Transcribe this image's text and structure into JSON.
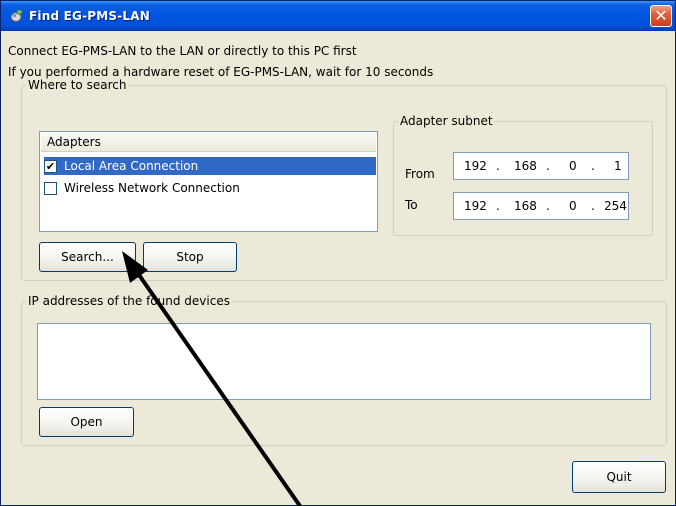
{
  "window": {
    "title": "Find EG-PMS-LAN",
    "close_glyph": "✕"
  },
  "intro": {
    "line1": "Connect EG-PMS-LAN to the LAN or directly to this PC first",
    "line2": "If you performed a hardware reset of EG-PMS-LAN, wait for 10 seconds"
  },
  "where_to_search": {
    "legend": "Where to search",
    "adapters": {
      "header": "Adapters",
      "items": [
        {
          "label": "Local Area Connection",
          "checked": true,
          "selected": true,
          "check_glyph": "✔"
        },
        {
          "label": "Wireless Network Connection",
          "checked": false,
          "selected": false,
          "check_glyph": ""
        }
      ]
    },
    "subnet": {
      "legend": "Adapter subnet",
      "from_label": "From",
      "to_label": "To",
      "from": [
        "192",
        ".",
        "168",
        ".",
        "0",
        ".",
        "1"
      ],
      "to": [
        "192",
        ".",
        "168",
        ".",
        "0",
        ".",
        "254"
      ]
    },
    "search_button": "Search...",
    "stop_button": "Stop"
  },
  "found": {
    "legend": "IP addresses of the found devices",
    "open_button": "Open"
  },
  "quit_button": "Quit",
  "colors": {
    "titlebar": "#0054e3",
    "window_bg": "#ece9d8",
    "selection": "#3169c6",
    "close_button": "#e0603a"
  },
  "icons": [
    "app-icon",
    "close-icon",
    "checkbox-checked-icon",
    "checkbox-unchecked-icon",
    "pointer-arrow-annotation"
  ]
}
